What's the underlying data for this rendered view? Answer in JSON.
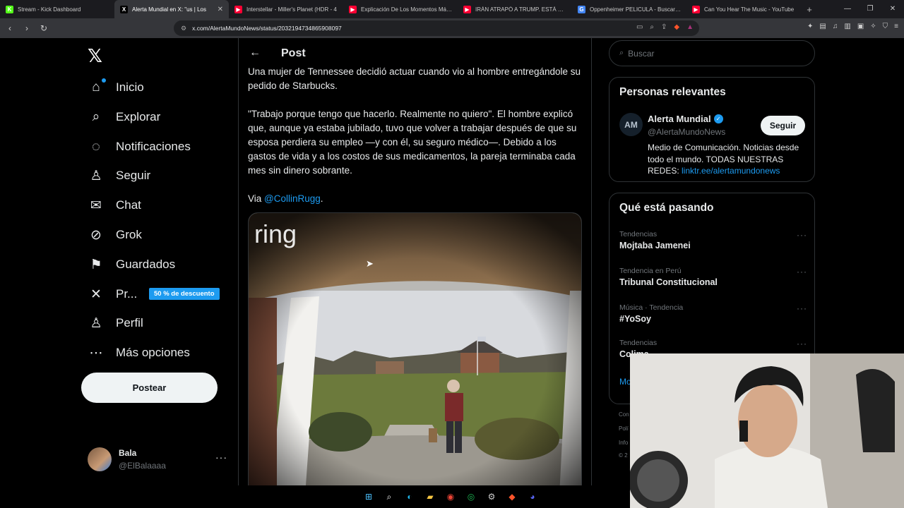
{
  "browser": {
    "tabs": [
      {
        "title": "Stream - Kick Dashboard",
        "color": "#53fc18",
        "glyph": "K",
        "active": false
      },
      {
        "title": "Alerta Mundial en X: \"us | Los",
        "color": "#000000",
        "glyph": "X",
        "active": true
      },
      {
        "title": "Interstellar - Miller's Planet (HDR - 4",
        "color": "#ff0033",
        "glyph": "▶",
        "active": false
      },
      {
        "title": "Explicación De Los Momentos Más C",
        "color": "#ff0033",
        "glyph": "▶",
        "active": false
      },
      {
        "title": "IRÁN ATRAPÓ A TRUMP. ESTÁ TOTAL",
        "color": "#ff0033",
        "glyph": "▶",
        "active": false
      },
      {
        "title": "Oppenheimer PELICULA - Buscar co",
        "color": "#4285f4",
        "glyph": "G",
        "active": false
      },
      {
        "title": "Can You Hear The Music - YouTube",
        "color": "#ff0033",
        "glyph": "▶",
        "active": false
      }
    ],
    "url": "x.com/AlertaMundoNews/status/2032194734865908097"
  },
  "nav": {
    "items": [
      {
        "label": "Inicio",
        "icon": "home-icon"
      },
      {
        "label": "Explorar",
        "icon": "search-icon"
      },
      {
        "label": "Notificaciones",
        "icon": "bell-icon"
      },
      {
        "label": "Seguir",
        "icon": "add-user-icon"
      },
      {
        "label": "Chat",
        "icon": "mail-icon"
      },
      {
        "label": "Grok",
        "icon": "grok-icon"
      },
      {
        "label": "Guardados",
        "icon": "bookmark-icon"
      },
      {
        "label": "Pr...",
        "icon": "x-premium-icon"
      },
      {
        "label": "Perfil",
        "icon": "person-icon"
      },
      {
        "label": "Más opciones",
        "icon": "more-circle-icon"
      }
    ],
    "promo_badge": "50 % de descuento",
    "post_button": "Postear",
    "profile": {
      "name": "Bala",
      "handle": "@ElBalaaaa"
    }
  },
  "post": {
    "header_title": "Post",
    "para1": "Una mujer de Tennessee decidió actuar cuando vio al hombre entregándole su pedido de Starbucks.",
    "para2": "\"Trabajo porque tengo que hacerlo. Realmente no quiero\". El hombre explicó que, aunque ya estaba jubilado, tuvo que volver a trabajar después de que su esposa perdiera su empleo —y con él, su seguro médico—. Debido a los gastos de vida y a los costos de sus medicamentos, la pareja terminaba cada mes sin dinero sobrante.",
    "via_prefix": "Via ",
    "via_mention": "@CollinRugg",
    "via_suffix": ".",
    "media_watermark": "ring"
  },
  "sidebar": {
    "search_placeholder": "Buscar",
    "relevant": {
      "title": "Personas relevantes",
      "name": "Alerta Mundial",
      "handle": "@AlertaMundoNews",
      "follow_label": "Seguir",
      "bio": "Medio de Comunicación. Noticias desde todo el mundo. TODAS NUESTRAS REDES: ",
      "bio_link": "linktr.ee/alertamundonews"
    },
    "trending": {
      "title": "Qué está pasando",
      "items": [
        {
          "meta": "Tendencias",
          "name": "Mojtaba Jamenei"
        },
        {
          "meta": "Tendencia en Perú",
          "name": "Tribunal Constitucional"
        },
        {
          "meta": "Música · Tendencia",
          "name": "#YoSoy"
        },
        {
          "meta": "Tendencias",
          "name": "Colima"
        }
      ],
      "show_more": "Mo"
    },
    "footer_fragments": [
      "Con",
      "Polí",
      "Info",
      "© 2"
    ]
  },
  "colors": {
    "accent": "#1d9bf0",
    "background": "#000000",
    "border": "#2f3336",
    "text": "#e7e9ea",
    "muted": "#71767b"
  }
}
